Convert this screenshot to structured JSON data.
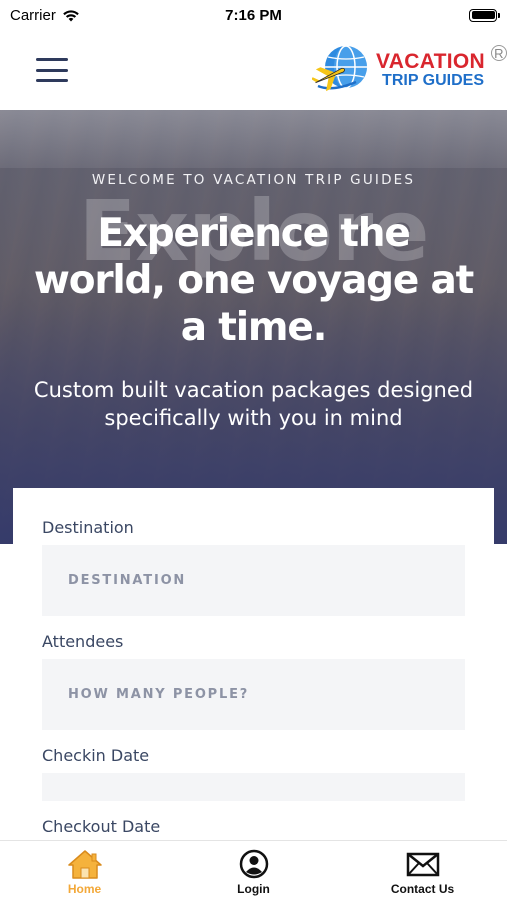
{
  "status": {
    "carrier": "Carrier",
    "time": "7:16 PM"
  },
  "header": {
    "menu_icon": "hamburger-menu-icon",
    "logo": {
      "line1": "VACATION",
      "line2": "TRIP GUIDES",
      "registered": "R"
    }
  },
  "hero": {
    "welcome": "WELCOME TO VACATION TRIP GUIDES",
    "ghost_word": "Explore",
    "headline": "Experience the world, one voyage at a time.",
    "subhead": "Custom built vacation packages designed specifically with you in mind"
  },
  "form": {
    "destination": {
      "label": "Destination",
      "placeholder": "DESTINATION"
    },
    "attendees": {
      "label": "Attendees",
      "placeholder": "HOW MANY PEOPLE?"
    },
    "checkin": {
      "label": "Checkin Date",
      "placeholder": ""
    },
    "checkout": {
      "label": "Checkout Date"
    }
  },
  "tabs": [
    {
      "label": "Home",
      "icon": "home-icon",
      "active": true
    },
    {
      "label": "Login",
      "icon": "user-circle-icon",
      "active": false
    },
    {
      "label": "Contact Us",
      "icon": "envelope-icon",
      "active": false
    }
  ],
  "colors": {
    "accent": "#f3a838",
    "brand_red": "#d9262e",
    "brand_blue": "#1f6fc9",
    "hero_bottom": "#343a6a"
  }
}
